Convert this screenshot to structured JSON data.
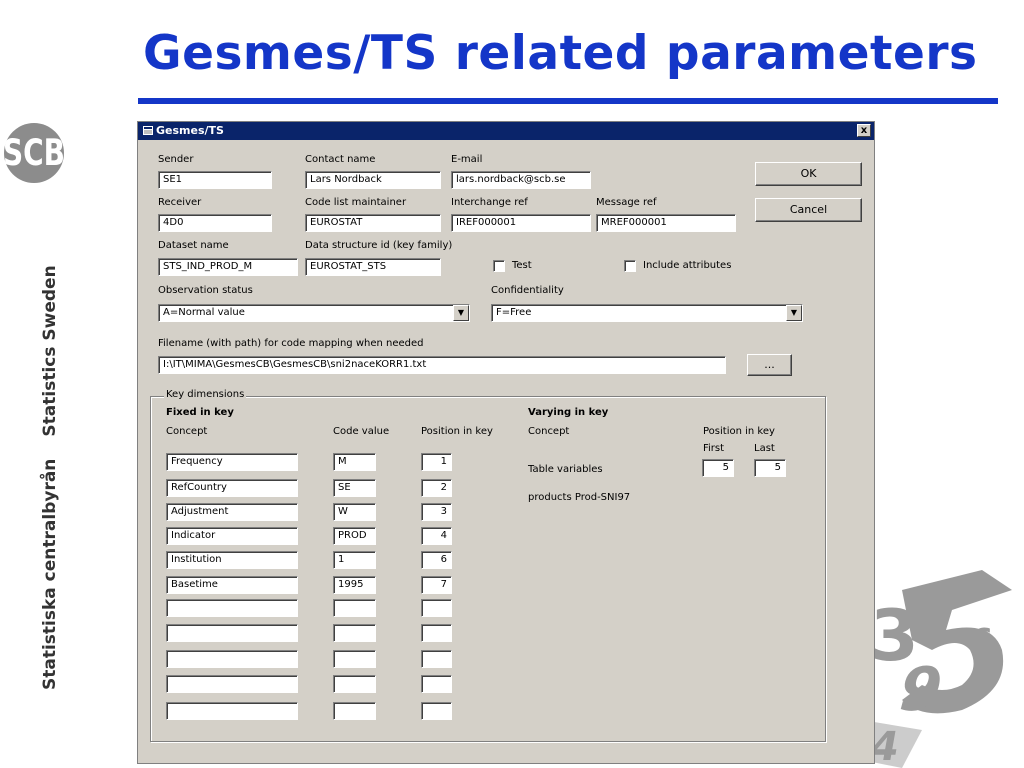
{
  "slide": {
    "title": "Gesmes/TS related parameters",
    "side_text_1": "Statistiska centralbyrån",
    "side_text_2": "Statistics Sweden"
  },
  "colors": {
    "title_blue": "#1436c8",
    "titlebar": "#0a246a",
    "dialog_bg": "#d4d0c8"
  },
  "dialog": {
    "title": "Gesmes/TS",
    "close": "x",
    "ok_label": "OK",
    "cancel_label": "Cancel",
    "sender_label": "Sender",
    "sender_value": "SE1",
    "contact_label": "Contact name",
    "contact_value": "Lars Nordback",
    "email_label": "E-mail",
    "email_value": "lars.nordback@scb.se",
    "receiver_label": "Receiver",
    "receiver_value": "4D0",
    "codelist_label": "Code list maintainer",
    "codelist_value": "EUROSTAT",
    "interchange_label": "Interchange ref",
    "interchange_value": "IREF000001",
    "message_label": "Message ref",
    "message_value": "MREF000001",
    "dataset_label": "Dataset name",
    "dataset_value": "STS_IND_PROD_M",
    "dsd_label": "Data structure id (key family)",
    "dsd_value": "EUROSTAT_STS",
    "test_label": "Test",
    "include_attr_label": "Include attributes",
    "obs_status_label": "Observation status",
    "obs_status_value": "A=Normal value",
    "confidentiality_label": "Confidentiality",
    "confidentiality_value": "F=Free",
    "filename_label": "Filename (with path) for code mapping when needed",
    "filename_value": "I:\\IT\\MIMA\\GesmesCB\\GesmesCB\\sni2naceKORR1.txt",
    "browse_label": "...",
    "key_dimensions": {
      "group_label": "Key dimensions",
      "fixed_heading": "Fixed in key",
      "concept_header": "Concept",
      "code_header": "Code value",
      "position_header": "Position in key",
      "rows": [
        {
          "concept": "Frequency",
          "code": "M",
          "position": "1"
        },
        {
          "concept": "RefCountry",
          "code": "SE",
          "position": "2"
        },
        {
          "concept": "Adjustment",
          "code": "W",
          "position": "3"
        },
        {
          "concept": "Indicator",
          "code": "PROD",
          "position": "4"
        },
        {
          "concept": "Institution",
          "code": "1",
          "position": "6"
        },
        {
          "concept": "Basetime",
          "code": "1995",
          "position": "7"
        },
        {
          "concept": "",
          "code": "",
          "position": ""
        },
        {
          "concept": "",
          "code": "",
          "position": ""
        },
        {
          "concept": "",
          "code": "",
          "position": ""
        },
        {
          "concept": "",
          "code": "",
          "position": ""
        },
        {
          "concept": "",
          "code": "",
          "position": ""
        }
      ],
      "varying_heading": "Varying in key",
      "varying_concept_header": "Concept",
      "varying_position_header": "Position in key",
      "first_label": "First",
      "last_label": "Last",
      "table_variables_label": "Table variables",
      "first_value": "5",
      "last_value": "5",
      "products_label": "products Prod-SNI97"
    }
  }
}
